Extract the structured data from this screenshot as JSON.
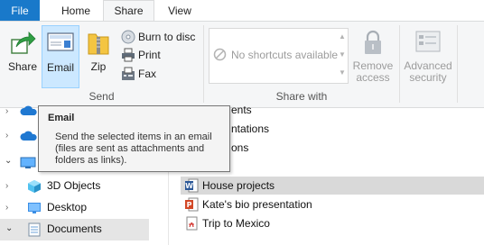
{
  "tabs": {
    "file": "File",
    "home": "Home",
    "share": "Share",
    "view": "View"
  },
  "ribbon": {
    "send": {
      "share_label": "Share",
      "email_label": "Email",
      "zip_label": "Zip",
      "burn_label": "Burn to disc",
      "print_label": "Print",
      "fax_label": "Fax",
      "group_label": "Send"
    },
    "share_with": {
      "no_shortcuts": "No shortcuts available",
      "remove_access_line1": "Remove",
      "remove_access_line2": "access",
      "group_label": "Share with"
    },
    "advanced_security_line1": "Advanced",
    "advanced_security_line2": "security"
  },
  "tooltip": {
    "title": "Email",
    "body": "Send the selected items in an email (files are sent as attachments and folders as links)."
  },
  "nav_pane": {
    "items": [
      {
        "label": "3D Objects",
        "icon": "3d-objects-icon"
      },
      {
        "label": "Desktop",
        "icon": "desktop-folder-icon"
      },
      {
        "label": "Documents",
        "icon": "documents-folder-icon"
      }
    ]
  },
  "file_list": {
    "partial_rows": [
      "ents",
      "ntations",
      "ons"
    ],
    "items": [
      {
        "name": "House projects",
        "icon": "word-doc-icon",
        "selected": true
      },
      {
        "name": "Kate's bio presentation",
        "icon": "powerpoint-icon",
        "selected": false
      },
      {
        "name": "Trip to Mexico",
        "icon": "pdf-icon",
        "selected": false
      }
    ]
  },
  "colors": {
    "file_tab": "#1979ca",
    "selection": "#cce8ff",
    "ribbon_bg": "#f5f6f7"
  }
}
